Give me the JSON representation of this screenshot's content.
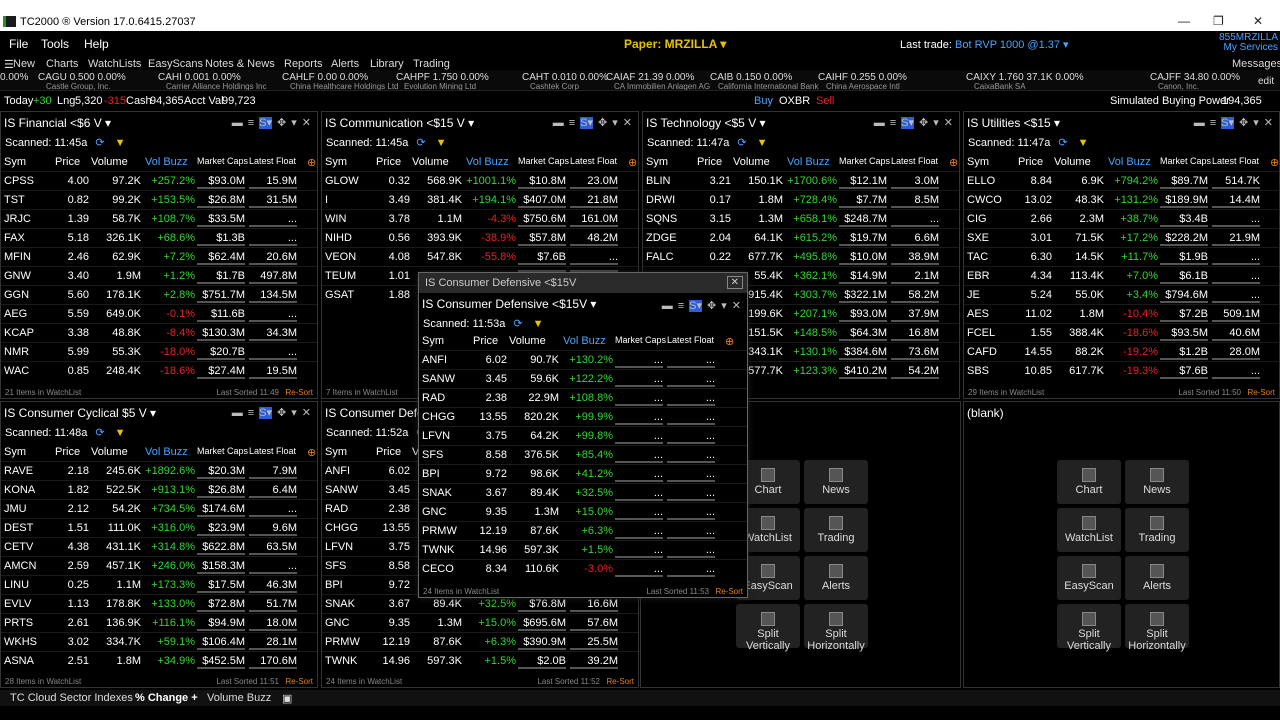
{
  "window": {
    "title": "TC2000 ® Version 17.0.6415.27037",
    "min": "—",
    "max": "❐",
    "close": "✕"
  },
  "menu": [
    "File",
    "Tools",
    "Help"
  ],
  "paper": "Paper: MRZILLA ▾",
  "last_trade": {
    "label": "Last trade:",
    "value": "Bot RVP 1000 @1.37 ▾"
  },
  "account": {
    "id": "855MRZILLA",
    "services": "My Services",
    "messages": "Messages",
    "edit": "edit"
  },
  "toolbar": [
    "New",
    "Charts",
    "WatchLists",
    "EasyScans",
    "Notes & News",
    "Reports",
    "Alerts",
    "Library",
    "Trading"
  ],
  "ticker": [
    {
      "t": "0.00%",
      "s": ""
    },
    {
      "t": "CAGU 0.500 0.00%",
      "s": "Castle Group, Inc."
    },
    {
      "t": "CAHI 0.001 0.00%",
      "s": "Carrier Alliance Holdings Inc"
    },
    {
      "t": "CAHLF 0.00 0.00%",
      "s": "China Healthcare Holdings Ltd"
    },
    {
      "t": "CAHPF 1.750 0.00%",
      "s": "Evolution Mining Ltd"
    },
    {
      "t": "CAHT 0.010 0.00%",
      "s": "Cashtek Corp"
    },
    {
      "t": "CAIAF 21.39 0.00%",
      "s": "CA Immobilien Anlagen AG"
    },
    {
      "t": "CAIB 0.150 0.00%",
      "s": "California International Bank"
    },
    {
      "t": "CAIHF 0.255 0.00%",
      "s": "China Aerospace Intl"
    },
    {
      "t": "CAIXY 1.760 37.1K 0.00%",
      "s": "CaixaBank SA"
    },
    {
      "t": "CAJFF 34.80 0.00%",
      "s": "Canon, Inc."
    }
  ],
  "acctbar": {
    "today_lbl": "Today",
    "today": "+30",
    "lng_lbl": "Lng",
    "lng": "5,320",
    "lng_chg": "-315",
    "cash_lbl": "Cash",
    "cash": "94,365",
    "val_lbl": "Acct Val",
    "val": "99,723",
    "buy": "Buy",
    "sym": "OXBR",
    "sell": "Sell",
    "sbp_lbl": "Simulated Buying Power",
    "sbp": "194,365"
  },
  "cols": {
    "sym": "Sym",
    "price": "Price",
    "volume": "Volume",
    "buzz": "Vol Buzz",
    "caps": "Market Caps",
    "float": "Latest Float"
  },
  "panels": [
    {
      "title": "IS Financial <$6 V ▾",
      "scanned": "Scanned:",
      "time": "11:45a",
      "footer": "21 Items in WatchList",
      "sorted": "Last Sorted 11:49",
      "resort": "Re-Sort",
      "rows": [
        [
          "CPSS",
          "4.00",
          "97.2K",
          "+257.2%",
          "$93.0M",
          "15.9M"
        ],
        [
          "TST",
          "0.82",
          "99.2K",
          "+153.5%",
          "$26.8M",
          "31.5M"
        ],
        [
          "JRJC",
          "1.39",
          "58.7K",
          "+108.7%",
          "$33.5M",
          "..."
        ],
        [
          "FAX",
          "5.18",
          "326.1K",
          "+68.6%",
          "$1.3B",
          "..."
        ],
        [
          "MFIN",
          "2.46",
          "62.9K",
          "+7.2%",
          "$62.4M",
          "20.6M"
        ],
        [
          "GNW",
          "3.40",
          "1.9M",
          "+1.2%",
          "$1.7B",
          "497.8M"
        ],
        [
          "GGN",
          "5.60",
          "178.1K",
          "+2.8%",
          "$751.7M",
          "134.5M"
        ],
        [
          "AEG",
          "5.59",
          "649.0K",
          "-0.1%",
          "$11.6B",
          "..."
        ],
        [
          "KCAP",
          "3.38",
          "48.8K",
          "-8.4%",
          "$130.3M",
          "34.3M"
        ],
        [
          "NMR",
          "5.99",
          "55.3K",
          "-18.0%",
          "$20.7B",
          "..."
        ],
        [
          "WAC",
          "0.85",
          "248.4K",
          "-18.6%",
          "$27.4M",
          "19.5M"
        ]
      ]
    },
    {
      "title": "IS Communication <$15 V ▾",
      "scanned": "Scanned:",
      "time": "11:45a",
      "footer": "7 Items in WatchList",
      "sorted": "",
      "resort": "",
      "rows": [
        [
          "GLOW",
          "0.32",
          "568.9K",
          "+1001.1%",
          "$10.8M",
          "23.0M"
        ],
        [
          "I",
          "3.49",
          "381.4K",
          "+194.1%",
          "$407.0M",
          "21.8M"
        ],
        [
          "WIN",
          "3.78",
          "1.1M",
          "-4.3%",
          "$750.6M",
          "161.0M"
        ],
        [
          "NIHD",
          "0.56",
          "393.9K",
          "-38.9%",
          "$57.8M",
          "48.2M"
        ],
        [
          "VEON",
          "4.08",
          "547.8K",
          "-55.8%",
          "$7.6B",
          "..."
        ],
        [
          "TEUM",
          "1.01",
          "",
          "",
          "",
          ""
        ],
        [
          "GSAT",
          "1.88",
          "",
          "",
          "",
          ""
        ]
      ]
    },
    {
      "title": "IS Technology <$5 V ▾",
      "scanned": "Scanned:",
      "time": "11:47a",
      "footer": "",
      "sorted": "",
      "resort": "",
      "rows": [
        [
          "BLIN",
          "3.21",
          "150.1K",
          "+1700.6%",
          "$12.1M",
          "3.0M"
        ],
        [
          "DRWI",
          "0.17",
          "1.8M",
          "+728.4%",
          "$7.7M",
          "8.5M"
        ],
        [
          "SQNS",
          "3.15",
          "1.3M",
          "+658.1%",
          "$248.7M",
          "..."
        ],
        [
          "ZDGE",
          "2.04",
          "64.1K",
          "+615.2%",
          "$19.7M",
          "6.6M"
        ],
        [
          "FALC",
          "0.22",
          "677.7K",
          "+495.8%",
          "$10.0M",
          "38.9M"
        ],
        [
          "",
          "",
          "55.4K",
          "+362.1%",
          "$14.9M",
          "2.1M"
        ],
        [
          "",
          "",
          "915.4K",
          "+303.7%",
          "$322.1M",
          "58.2M"
        ],
        [
          "",
          "",
          "199.6K",
          "+207.1%",
          "$93.0M",
          "37.9M"
        ],
        [
          "",
          "",
          "151.5K",
          "+148.5%",
          "$64.3M",
          "16.8M"
        ],
        [
          "",
          "",
          "343.1K",
          "+130.1%",
          "$384.6M",
          "73.6M"
        ],
        [
          "",
          "",
          "577.7K",
          "+123.3%",
          "$410.2M",
          "54.2M"
        ]
      ]
    },
    {
      "title": "IS Utilities <$15 ▾",
      "scanned": "Scanned:",
      "time": "11:47a",
      "footer": "29 Items in WatchList",
      "sorted": "Last Sorted 11:50",
      "resort": "Re-Sort",
      "rows": [
        [
          "ELLO",
          "8.84",
          "6.9K",
          "+794.2%",
          "$89.7M",
          "514.7K"
        ],
        [
          "CWCO",
          "13.02",
          "48.3K",
          "+131.2%",
          "$189.9M",
          "14.4M"
        ],
        [
          "CIG",
          "2.66",
          "2.3M",
          "+38.7%",
          "$3.4B",
          "..."
        ],
        [
          "SXE",
          "3.01",
          "71.5K",
          "+17.2%",
          "$228.2M",
          "21.9M"
        ],
        [
          "TAC",
          "6.30",
          "14.5K",
          "+11.7%",
          "$1.9B",
          "..."
        ],
        [
          "EBR",
          "4.34",
          "113.4K",
          "+7.0%",
          "$6.1B",
          "..."
        ],
        [
          "JE",
          "5.24",
          "55.0K",
          "+3.4%",
          "$794.6M",
          "..."
        ],
        [
          "AES",
          "11.02",
          "1.8M",
          "-10.4%",
          "$7.2B",
          "509.1M"
        ],
        [
          "FCEL",
          "1.55",
          "388.4K",
          "-18.6%",
          "$93.5M",
          "40.6M"
        ],
        [
          "CAFD",
          "14.55",
          "88.2K",
          "-19.2%",
          "$1.2B",
          "28.0M"
        ],
        [
          "SBS",
          "10.85",
          "617.7K",
          "-19.3%",
          "$7.6B",
          "..."
        ]
      ]
    },
    {
      "title": "IS Consumer Cyclical $5 V ▾",
      "scanned": "Scanned:",
      "time": "11:48a",
      "footer": "28 Items in WatchList",
      "sorted": "Last Sorted 11:51",
      "resort": "Re-Sort",
      "rows": [
        [
          "RAVE",
          "2.18",
          "245.6K",
          "+1892.6%",
          "$20.3M",
          "7.9M"
        ],
        [
          "KONA",
          "1.82",
          "522.5K",
          "+913.1%",
          "$26.8M",
          "6.4M"
        ],
        [
          "JMU",
          "2.12",
          "54.2K",
          "+734.5%",
          "$174.6M",
          "..."
        ],
        [
          "DEST",
          "1.51",
          "111.0K",
          "+316.0%",
          "$23.9M",
          "9.6M"
        ],
        [
          "CETV",
          "4.38",
          "431.1K",
          "+314.8%",
          "$622.8M",
          "63.5M"
        ],
        [
          "AMCN",
          "2.59",
          "457.1K",
          "+246.0%",
          "$158.3M",
          "..."
        ],
        [
          "LINU",
          "0.25",
          "1.1M",
          "+173.3%",
          "$17.5M",
          "46.3M"
        ],
        [
          "EVLV",
          "1.13",
          "178.8K",
          "+133.0%",
          "$72.8M",
          "51.7M"
        ],
        [
          "PRTS",
          "2.61",
          "136.9K",
          "+116.1%",
          "$94.9M",
          "18.0M"
        ],
        [
          "WKHS",
          "3.02",
          "334.7K",
          "+59.1%",
          "$106.4M",
          "28.1M"
        ],
        [
          "ASNA",
          "2.51",
          "1.8M",
          "+34.9%",
          "$452.5M",
          "170.6M"
        ]
      ]
    },
    {
      "title": "IS Consumer Defe",
      "scanned": "Scanned:",
      "time": "11:52a",
      "footer": "24 Items in WatchList",
      "sorted": "Last Sorted 11:52",
      "resort": "Re-Sort",
      "rows": [
        [
          "ANFI",
          "6.02",
          "",
          "",
          "",
          ""
        ],
        [
          "SANW",
          "3.45",
          "",
          "",
          "",
          ""
        ],
        [
          "RAD",
          "2.38",
          "",
          "",
          "",
          ""
        ],
        [
          "CHGG",
          "13.55",
          "",
          "",
          "",
          ""
        ],
        [
          "LFVN",
          "3.75",
          "",
          "",
          "",
          ""
        ],
        [
          "SFS",
          "8.58",
          "",
          "",
          "",
          ""
        ],
        [
          "BPI",
          "9.72",
          "",
          "",
          "",
          ""
        ],
        [
          "SNAK",
          "3.67",
          "89.4K",
          "+32.5%",
          "$76.8M",
          "16.6M"
        ],
        [
          "GNC",
          "9.35",
          "1.3M",
          "+15.0%",
          "$695.6M",
          "57.6M"
        ],
        [
          "PRMW",
          "12.19",
          "87.6K",
          "+6.3%",
          "$390.9M",
          "25.5M"
        ],
        [
          "TWNK",
          "14.96",
          "597.3K",
          "+1.5%",
          "$2.0B",
          "39.2M"
        ]
      ]
    }
  ],
  "floating": {
    "wintitle": "IS Consumer Defensive <$15V",
    "title": "IS Consumer Defensive <$15V ▾",
    "scanned": "Scanned:",
    "time": "11:53a",
    "footer": "24 Items in WatchList",
    "sorted": "Last Sorted 11:53",
    "resort": "Re-Sort",
    "rows": [
      [
        "ANFI",
        "6.02",
        "90.7K",
        "+130.2%",
        "...",
        "..."
      ],
      [
        "SANW",
        "3.45",
        "59.6K",
        "+122.2%",
        "...",
        "..."
      ],
      [
        "RAD",
        "2.38",
        "22.9M",
        "+108.8%",
        "...",
        "..."
      ],
      [
        "CHGG",
        "13.55",
        "820.2K",
        "+99.9%",
        "...",
        "..."
      ],
      [
        "LFVN",
        "3.75",
        "64.2K",
        "+99.8%",
        "...",
        "..."
      ],
      [
        "SFS",
        "8.58",
        "376.5K",
        "+85.4%",
        "...",
        "..."
      ],
      [
        "BPI",
        "9.72",
        "98.6K",
        "+41.2%",
        "...",
        "..."
      ],
      [
        "SNAK",
        "3.67",
        "89.4K",
        "+32.5%",
        "...",
        "..."
      ],
      [
        "GNC",
        "9.35",
        "1.3M",
        "+15.0%",
        "...",
        "..."
      ],
      [
        "PRMW",
        "12.19",
        "87.6K",
        "+6.3%",
        "...",
        "..."
      ],
      [
        "TWNK",
        "14.96",
        "597.3K",
        "+1.5%",
        "...",
        "..."
      ],
      [
        "CECO",
        "8.34",
        "110.6K",
        "-3.0%",
        "...",
        "..."
      ]
    ]
  },
  "blank_title": "(blank)",
  "tiles": [
    "Chart",
    "News",
    "WatchList",
    "Trading",
    "EasyScan",
    "Alerts",
    "Split Vertically",
    "Split Horizontally"
  ],
  "tabs": [
    "TC Cloud Sector Indexes",
    "% Change +",
    "Volume Buzz"
  ]
}
